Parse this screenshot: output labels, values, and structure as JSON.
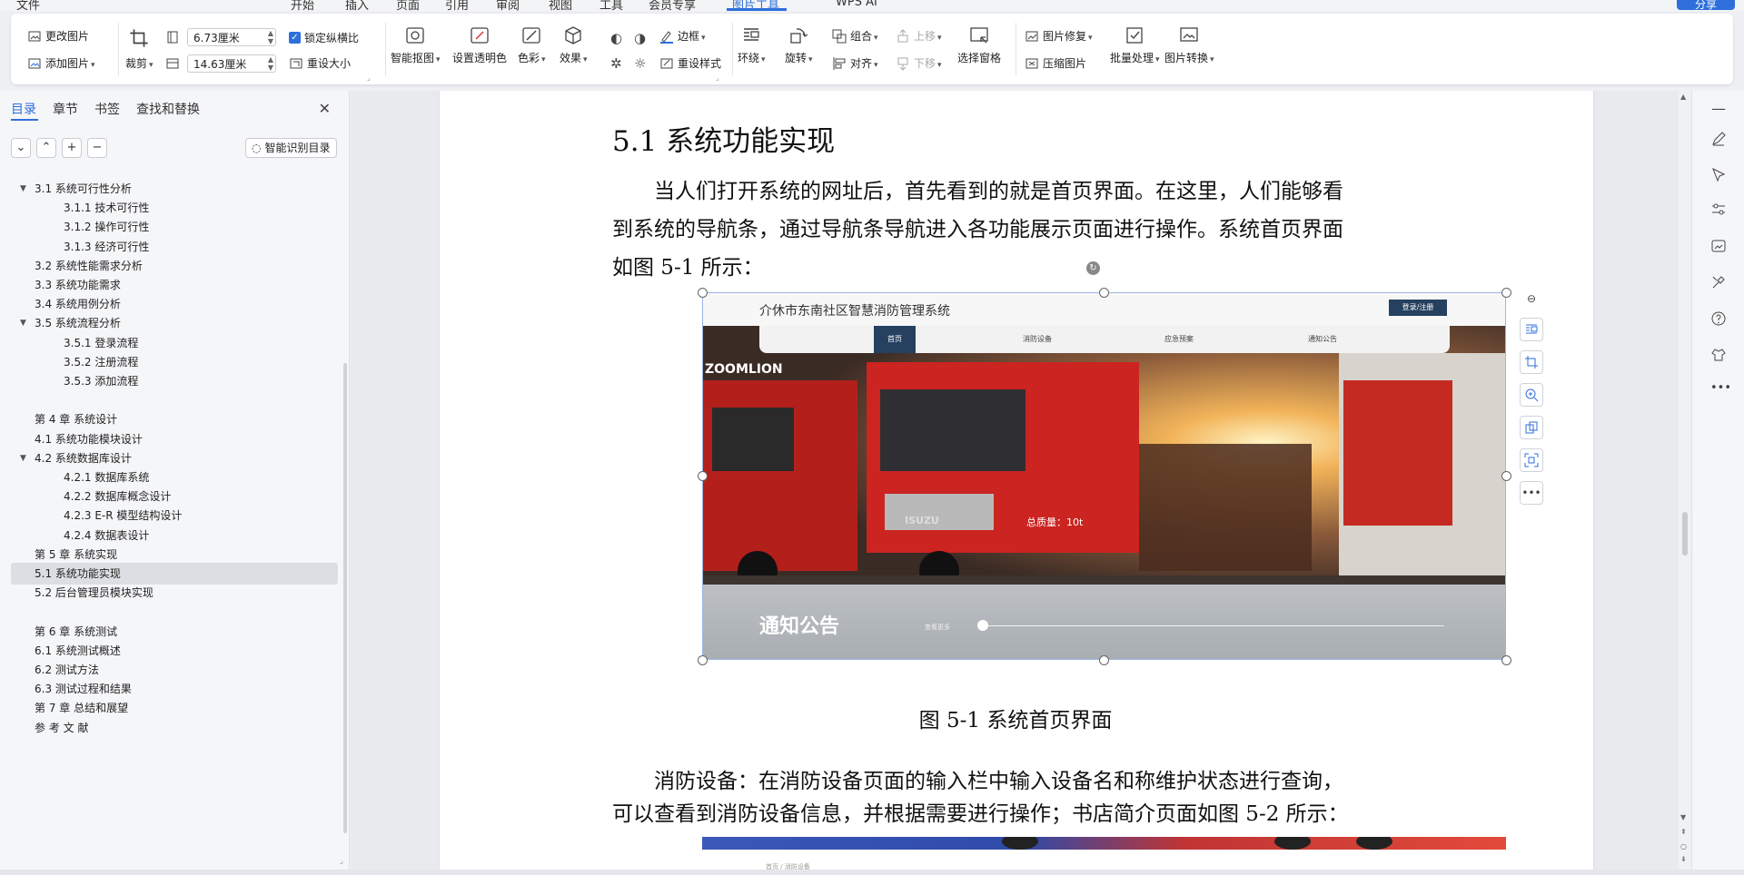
{
  "menu": {
    "file": "文件",
    "tabs": [
      "开始",
      "插入",
      "页面",
      "引用",
      "审阅",
      "视图",
      "工具",
      "会员专享",
      "图片工具"
    ],
    "active_tab": "图片工具",
    "wps_ai": "WPS AI",
    "share": "分享"
  },
  "ribbon": {
    "change_picture": "更改图片",
    "add_picture": "添加图片",
    "crop": "裁剪",
    "width_value": "6.73厘米",
    "height_value": "14.63厘米",
    "lock_ratio": "锁定纵横比",
    "reset_size": "重设大小",
    "smart_cutout": "智能抠图",
    "set_transparent": "设置透明色",
    "color": "色彩",
    "effects": "效果",
    "border": "边框",
    "reset_style": "重设样式",
    "wrap": "环绕",
    "rotate": "旋转",
    "group": "组合",
    "align": "对齐",
    "bring_forward": "上移",
    "send_backward": "下移",
    "selection_pane": "选择窗格",
    "picture_repair": "图片修复",
    "compress": "压缩图片",
    "batch": "批量处理",
    "convert": "图片转换"
  },
  "nav": {
    "tabs": [
      "目录",
      "章节",
      "书签",
      "查找和替换"
    ],
    "active_tab": "目录",
    "smart_toc": "智能识别目录",
    "items": [
      {
        "label": "3.1  系统可行性分析",
        "level": 1,
        "expanded": true
      },
      {
        "label": "3.1.1  技术可行性",
        "level": 2
      },
      {
        "label": "3.1.2  操作可行性",
        "level": 2
      },
      {
        "label": "3.1.3  经济可行性",
        "level": 2
      },
      {
        "label": "3.2 系统性能需求分析",
        "level": 1
      },
      {
        "label": "3.3 系统功能需求",
        "level": 1
      },
      {
        "label": "3.4  系统用例分析",
        "level": 1
      },
      {
        "label": "3.5  系统流程分析",
        "level": 1,
        "expanded": true
      },
      {
        "label": "3.5.1  登录流程",
        "level": 2
      },
      {
        "label": "3.5.2  注册流程",
        "level": 2
      },
      {
        "label": "3.5.3  添加流程",
        "level": 2
      },
      {
        "label": "",
        "level": 1
      },
      {
        "label": "第 4 章  系统设计",
        "level": 1
      },
      {
        "label": "4.1 系统功能模块设计",
        "level": 1
      },
      {
        "label": "4.2  系统数据库设计",
        "level": 1,
        "expanded": true
      },
      {
        "label": "4.2.1  数据库系统",
        "level": 2
      },
      {
        "label": "4.2.2  数据库概念设计",
        "level": 2
      },
      {
        "label": "4.2.3 E-R 模型结构设计",
        "level": 2
      },
      {
        "label": "4.2.4 数据表设计",
        "level": 2
      },
      {
        "label": "第 5 章  系统实现",
        "level": 1
      },
      {
        "label": "5.1 系统功能实现",
        "level": 1,
        "selected": true
      },
      {
        "label": "5.2 后台管理员模块实现",
        "level": 1
      },
      {
        "label": "",
        "level": 1
      },
      {
        "label": "第 6 章    系统测试",
        "level": 1
      },
      {
        "label": "6.1  系统测试概述",
        "level": 1
      },
      {
        "label": "6.2  测试方法",
        "level": 1
      },
      {
        "label": "6.3  测试过程和结果",
        "level": 1
      },
      {
        "label": "第 7 章  总结和展望",
        "level": 1
      },
      {
        "label": "参 考 文 献",
        "level": 1
      }
    ]
  },
  "document": {
    "heading": "5.1 系统功能实现",
    "para1_lines": [
      "　　当人们打开系统的网址后，首先看到的就是首页界面。在这里，人们能够看",
      "到系统的导航条，通过导航条导航进入各功能展示页面进行操作。系统首页界面",
      "如图 5-1 所示："
    ],
    "figure_caption": "图 5-1  系统首页界面",
    "para2_lines": [
      "　　消防设备：在消防设备页面的输入栏中输入设备名和称维护状态进行查询，",
      "可以查看到消防设备信息，并根据需要进行操作；书店简介页面如图 5-2 所示："
    ],
    "screenshot": {
      "site_title": "介休市东南社区智慧消防管理系统",
      "login_button": "登录/注册",
      "nav_items": [
        "首页",
        "消防设备",
        "应急预案",
        "通知公告"
      ],
      "active_nav": "首页",
      "hero_text_brand": "ZOOMLION",
      "hero_text_truck": "ISUZU",
      "hero_text_weight": "总质量：10t",
      "notice_title": "通知公告",
      "notice_sub": "查看更多"
    },
    "next_screenshot_crumb": "首页 / 消防设备"
  },
  "colors": {
    "accent": "#2e6fdb",
    "site_nav_active": "#26415f"
  }
}
